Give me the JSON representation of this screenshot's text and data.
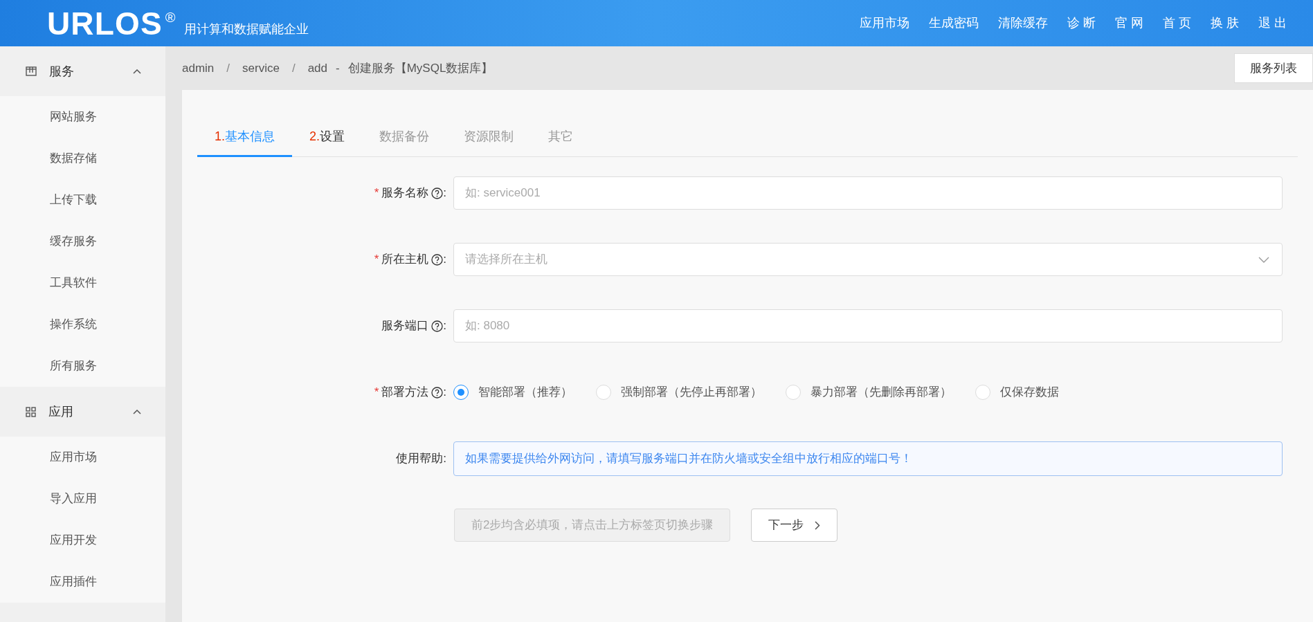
{
  "header": {
    "logo": "URLOS",
    "logo_mark": "®",
    "tagline": "用计算和数据赋能企业",
    "nav": [
      "应用市场",
      "生成密码",
      "清除缓存",
      "诊 断",
      "官 网",
      "首 页",
      "换 肤",
      "退 出"
    ]
  },
  "sidebar": {
    "groups": [
      {
        "label": "服务",
        "kind": "service",
        "expanded": true,
        "items": [
          "网站服务",
          "数据存储",
          "上传下载",
          "缓存服务",
          "工具软件",
          "操作系统",
          "所有服务"
        ]
      },
      {
        "label": "应用",
        "kind": "apps",
        "expanded": true,
        "items": [
          "应用市场",
          "导入应用",
          "应用开发",
          "应用插件"
        ]
      }
    ]
  },
  "breadcrumb": {
    "items": [
      "admin",
      "service",
      "add"
    ],
    "separator": "/",
    "dash": "-",
    "title": "创建服务【MySQL数据库】",
    "button": "服务列表"
  },
  "tabs": [
    {
      "step": "1.",
      "label": "基本信息",
      "selected": true,
      "disabled": false
    },
    {
      "step": "2.",
      "label": "设置",
      "selected": false,
      "disabled": false
    },
    {
      "label": "数据备份",
      "selected": false,
      "disabled": true
    },
    {
      "label": "资源限制",
      "selected": false,
      "disabled": true
    },
    {
      "label": "其它",
      "selected": false,
      "disabled": true
    }
  ],
  "form": {
    "required_mark": "*",
    "colon": ":",
    "fields": [
      {
        "kind": "input",
        "label": "服务名称",
        "required": true,
        "help": true,
        "placeholder": "如: service001"
      },
      {
        "kind": "select",
        "label": "所在主机",
        "required": true,
        "help": true,
        "placeholder": "请选择所在主机"
      },
      {
        "kind": "input",
        "label": "服务端口",
        "required": false,
        "help": true,
        "placeholder": "如: 8080"
      },
      {
        "kind": "radio",
        "label": "部署方法",
        "required": true,
        "help": true,
        "options": [
          {
            "label": "智能部署（推荐）",
            "selected": true
          },
          {
            "label": "强制部署（先停止再部署）",
            "selected": false
          },
          {
            "label": "暴力部署（先删除再部署）",
            "selected": false
          },
          {
            "label": "仅保存数据",
            "selected": false
          }
        ]
      },
      {
        "kind": "info",
        "label": "使用帮助",
        "required": false,
        "help": false,
        "text": "如果需要提供给外网访问，请填写服务端口并在防火墙或安全组中放行相应的端口号！"
      }
    ],
    "buttons": [
      {
        "label": "前2步均含必填项，请点击上方标签页切换步骤",
        "disabled": true
      },
      {
        "label": "下一步",
        "disabled": false
      }
    ]
  }
}
